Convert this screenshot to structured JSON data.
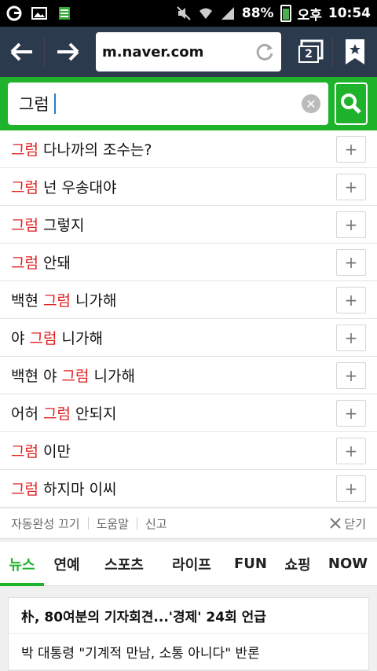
{
  "status_bar": {
    "battery": "88%",
    "ampm": "오후",
    "time": "10:54"
  },
  "browser": {
    "url": "m.naver.com",
    "tab_count": "2"
  },
  "search": {
    "query": "그럼"
  },
  "suggestions": [
    {
      "pre": "",
      "hl": "그럼",
      "post": " 다나까의 조수는?"
    },
    {
      "pre": "",
      "hl": "그럼",
      "post": " 넌 우송대야"
    },
    {
      "pre": "",
      "hl": "그럼",
      "post": " 그렇지"
    },
    {
      "pre": "",
      "hl": "그럼",
      "post": " 안돼"
    },
    {
      "pre": "백현 ",
      "hl": "그럼",
      "post": " 니가해"
    },
    {
      "pre": "야 ",
      "hl": "그럼",
      "post": " 니가해"
    },
    {
      "pre": "백현 야 ",
      "hl": "그럼",
      "post": " 니가해"
    },
    {
      "pre": "어허 ",
      "hl": "그럼",
      "post": " 안되지"
    },
    {
      "pre": "",
      "hl": "그럼",
      "post": " 이만"
    },
    {
      "pre": "",
      "hl": "그럼",
      "post": " 하지마 이씨"
    }
  ],
  "suggest_footer": {
    "autocomplete_off": "자동완성 끄기",
    "help": "도움말",
    "report": "신고",
    "close": "닫기"
  },
  "categories": [
    "뉴스",
    "연예",
    "스포츠",
    "라이프",
    "FUN",
    "쇼핑",
    "NOW"
  ],
  "news": [
    "朴, 80여분의 기자회견...'경제' 24회 언급",
    "박 대통령 \"기계적 만남, 소통 아니다\" 반론"
  ],
  "colors": {
    "brand_green": "#1fb32c",
    "highlight_red": "#e0201f",
    "toolbar": "#2b3a4d"
  }
}
